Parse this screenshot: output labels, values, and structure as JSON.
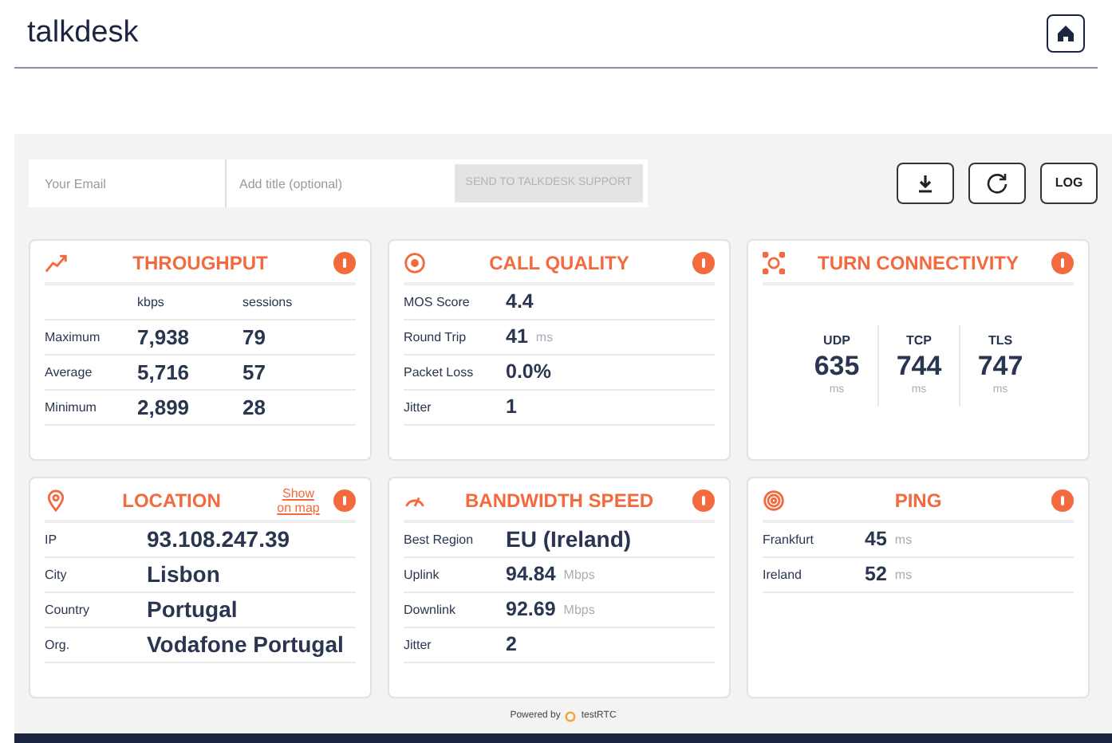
{
  "header": {
    "logo": "talkdesk"
  },
  "support": {
    "email_placeholder": "Your Email",
    "title_placeholder": "Add title (optional)",
    "send_button": "SEND TO TALKDESK SUPPORT",
    "send_disabled": true
  },
  "toolbar": {
    "log_button": "LOG"
  },
  "cards": [
    {
      "kind": "table",
      "title": "THROUGHPUT",
      "alert": true,
      "columns": [
        "kbps",
        "sessions"
      ],
      "rows": [
        {
          "label": "Maximum",
          "values": [
            "7,938",
            "79"
          ]
        },
        {
          "label": "Average",
          "values": [
            "5,716",
            "57"
          ]
        },
        {
          "label": "Minimum",
          "values": [
            "2,899",
            "28"
          ]
        }
      ]
    },
    {
      "kind": "list",
      "title": "CALL QUALITY",
      "alert": true,
      "rows": [
        {
          "label": "MOS Score",
          "value": "4.4",
          "large": false
        },
        {
          "label": "Round Trip",
          "value": "41",
          "unit": "ms",
          "large": false
        },
        {
          "label": "Packet Loss",
          "value": "0.0%",
          "large": false
        },
        {
          "label": "Jitter",
          "value": "1",
          "large": false
        }
      ]
    },
    {
      "kind": "columns",
      "title": "TURN CONNECTIVITY",
      "alert": true,
      "columns": [
        {
          "label": "UDP",
          "value": "635",
          "unit": "ms"
        },
        {
          "label": "TCP",
          "value": "744",
          "unit": "ms"
        },
        {
          "label": "TLS",
          "value": "747",
          "unit": "ms"
        }
      ]
    },
    {
      "kind": "list",
      "title": "LOCATION",
      "link": "Show on map",
      "alert": true,
      "rows": [
        {
          "label": "IP",
          "value": "93.108.247.39",
          "large": true
        },
        {
          "label": "City",
          "value": "Lisbon",
          "large": true
        },
        {
          "label": "Country",
          "value": "Portugal",
          "large": true
        },
        {
          "label": "Org.",
          "value": "Vodafone Portugal",
          "large": true
        }
      ]
    },
    {
      "kind": "list",
      "title": "BANDWIDTH SPEED",
      "alert": true,
      "rows": [
        {
          "label": "Best Region",
          "value": "EU (Ireland)",
          "large": true
        },
        {
          "label": "Uplink",
          "value": "94.84",
          "unit": "Mbps",
          "large": false
        },
        {
          "label": "Downlink",
          "value": "92.69",
          "unit": "Mbps",
          "large": false
        },
        {
          "label": "Jitter",
          "value": "2",
          "large": false
        }
      ]
    },
    {
      "kind": "list",
      "title": "PING",
      "alert": true,
      "rows": [
        {
          "label": "Frankfurt",
          "value": "45",
          "unit": "ms",
          "large": false
        },
        {
          "label": "Ireland",
          "value": "52",
          "unit": "ms",
          "large": false
        }
      ]
    }
  ],
  "footer": {
    "powered_by": "Powered by",
    "brand": "testRTC"
  }
}
